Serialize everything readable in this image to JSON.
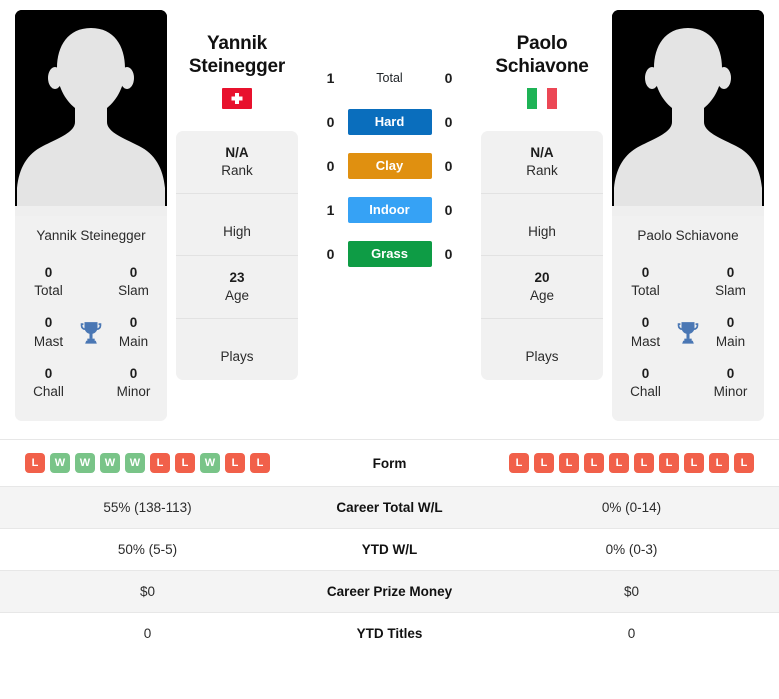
{
  "players": {
    "left": {
      "first_name": "Yannik",
      "last_name": "Steinegger",
      "full_name": "Yannik Steinegger",
      "flag_name": "switzerland-flag",
      "flag_colors": {
        "field": "#e8112d",
        "cross": "#ffffff"
      },
      "trophies": {
        "total_value": "0",
        "total_label": "Total",
        "slam_value": "0",
        "slam_label": "Slam",
        "mast_value": "0",
        "mast_label": "Mast",
        "main_value": "0",
        "main_label": "Main",
        "chall_value": "0",
        "chall_label": "Chall",
        "minor_value": "0",
        "minor_label": "Minor"
      },
      "info": {
        "rank_value": "N/A",
        "rank_label": "Rank",
        "high_value": "",
        "high_label": "High",
        "age_value": "23",
        "age_label": "Age",
        "plays_value": "",
        "plays_label": "Plays"
      },
      "form": [
        "L",
        "W",
        "W",
        "W",
        "W",
        "L",
        "L",
        "W",
        "L",
        "L"
      ],
      "career_total_wl": "55% (138-113)",
      "ytd_wl": "50% (5-5)",
      "career_prize_money": "$0",
      "ytd_titles": "0"
    },
    "right": {
      "first_name": "Paolo",
      "last_name": "Schiavone",
      "full_name": "Paolo Schiavone",
      "flag_name": "italy-flag",
      "flag_colors": {
        "green": "#1eb356",
        "white": "#ffffff",
        "red": "#ec4755"
      },
      "trophies": {
        "total_value": "0",
        "total_label": "Total",
        "slam_value": "0",
        "slam_label": "Slam",
        "mast_value": "0",
        "mast_label": "Mast",
        "main_value": "0",
        "main_label": "Main",
        "chall_value": "0",
        "chall_label": "Chall",
        "minor_value": "0",
        "minor_label": "Minor"
      },
      "info": {
        "rank_value": "N/A",
        "rank_label": "Rank",
        "high_value": "",
        "high_label": "High",
        "age_value": "20",
        "age_label": "Age",
        "plays_value": "",
        "plays_label": "Plays"
      },
      "form": [
        "L",
        "L",
        "L",
        "L",
        "L",
        "L",
        "L",
        "L",
        "L",
        "L"
      ],
      "career_total_wl": "0% (0-14)",
      "ytd_wl": "0% (0-3)",
      "career_prize_money": "$0",
      "ytd_titles": "0"
    }
  },
  "head_to_head": [
    {
      "label": "Total",
      "left": "1",
      "right": "0",
      "color": "",
      "plain": true
    },
    {
      "label": "Hard",
      "left": "0",
      "right": "0",
      "color": "#0a6ebd",
      "plain": false
    },
    {
      "label": "Clay",
      "left": "0",
      "right": "0",
      "color": "#e09010",
      "plain": false
    },
    {
      "label": "Indoor",
      "left": "1",
      "right": "0",
      "color": "#36a2f5",
      "plain": false
    },
    {
      "label": "Grass",
      "left": "0",
      "right": "0",
      "color": "#0e9c45",
      "plain": false
    }
  ],
  "table_rows": [
    {
      "label": "Form",
      "key": "form",
      "type": "form"
    },
    {
      "label": "Career Total W/L",
      "key": "career_total_wl",
      "type": "text"
    },
    {
      "label": "YTD W/L",
      "key": "ytd_wl",
      "type": "text"
    },
    {
      "label": "Career Prize Money",
      "key": "career_prize_money",
      "type": "text"
    },
    {
      "label": "YTD Titles",
      "key": "ytd_titles",
      "type": "text"
    }
  ],
  "badge_colors": {
    "win": "#79c488",
    "loss": "#f1604a"
  },
  "trophy_icon_color": "#4a77b4"
}
